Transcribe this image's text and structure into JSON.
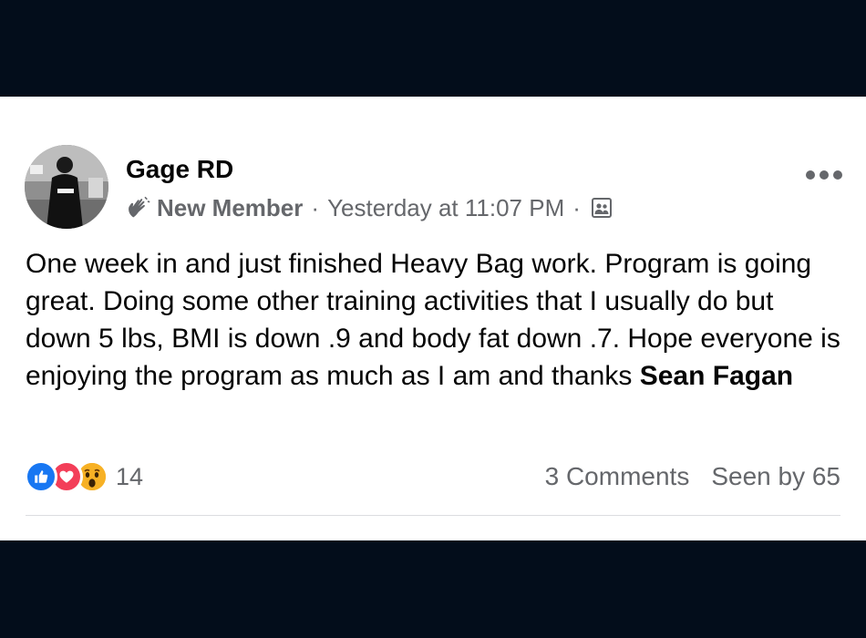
{
  "post": {
    "author": "Gage RD",
    "badge": "New Member",
    "separator": "·",
    "timestamp": "Yesterday at 11:07 PM",
    "audience_icon": "group-icon",
    "badge_icon": "wave-icon",
    "text_before_mention": "One week in and just finished Heavy Bag work. Program is going great. Doing some other training activities that I usually do but down 5 lbs, BMI is down .9 and body fat down .7. Hope everyone is enjoying the program as much as I am and thanks ",
    "mention": "Sean Fagan"
  },
  "footer": {
    "reactions": [
      "like-icon",
      "love-icon",
      "wow-icon"
    ],
    "reaction_count": "14",
    "comments": "3 Comments",
    "seen_by": "Seen by 65"
  },
  "colors": {
    "background": "#030d1b",
    "card": "#ffffff",
    "secondary_text": "#65676b",
    "like": "#1877f2",
    "love": "#f33e58",
    "wow": "#f7b125"
  }
}
